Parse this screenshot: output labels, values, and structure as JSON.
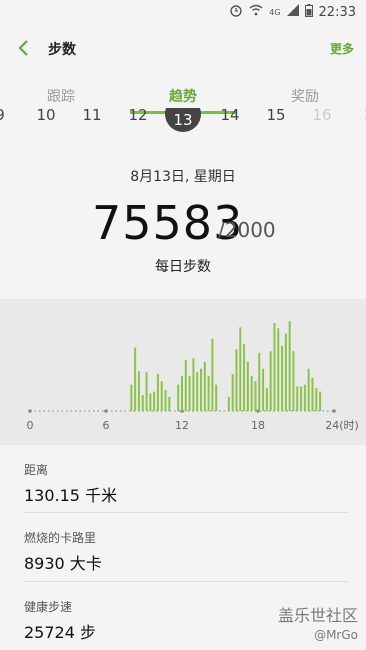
{
  "status": {
    "network": "4G",
    "time": "22:33"
  },
  "header": {
    "title": "步数",
    "more_label": "更多"
  },
  "tabs": [
    {
      "label": "跟踪"
    },
    {
      "label": "趋势",
      "active": true
    },
    {
      "label": "奖励"
    }
  ],
  "days": [
    "9",
    "10",
    "11",
    "12",
    "13",
    "14",
    "15",
    "16",
    "1"
  ],
  "selected_day": "13",
  "summary": {
    "date": "8月13日, 星期日",
    "steps": "75583",
    "goal": "/2000",
    "label": "每日步数"
  },
  "chart_data": {
    "type": "bar",
    "xlabel": "",
    "ylabel": "",
    "x_tick_labels": [
      "0",
      "6",
      "12",
      "18",
      "24(时)"
    ],
    "x_range": [
      0,
      24
    ],
    "bar_color": "#8bc34a",
    "bars": [
      {
        "x": 8.0,
        "v": 0.3
      },
      {
        "x": 8.3,
        "v": 0.72
      },
      {
        "x": 8.6,
        "v": 0.45
      },
      {
        "x": 8.9,
        "v": 0.18
      },
      {
        "x": 9.2,
        "v": 0.44
      },
      {
        "x": 9.5,
        "v": 0.2
      },
      {
        "x": 9.8,
        "v": 0.22
      },
      {
        "x": 10.1,
        "v": 0.42
      },
      {
        "x": 10.4,
        "v": 0.34
      },
      {
        "x": 10.7,
        "v": 0.24
      },
      {
        "x": 11.0,
        "v": 0.16
      },
      {
        "x": 11.7,
        "v": 0.3
      },
      {
        "x": 12.0,
        "v": 0.4
      },
      {
        "x": 12.3,
        "v": 0.58
      },
      {
        "x": 12.6,
        "v": 0.4
      },
      {
        "x": 12.9,
        "v": 0.6
      },
      {
        "x": 13.2,
        "v": 0.44
      },
      {
        "x": 13.5,
        "v": 0.48
      },
      {
        "x": 13.8,
        "v": 0.56
      },
      {
        "x": 14.1,
        "v": 0.4
      },
      {
        "x": 14.4,
        "v": 0.82
      },
      {
        "x": 14.7,
        "v": 0.3
      },
      {
        "x": 15.7,
        "v": 0.16
      },
      {
        "x": 16.0,
        "v": 0.42
      },
      {
        "x": 16.3,
        "v": 0.7
      },
      {
        "x": 16.6,
        "v": 0.95
      },
      {
        "x": 16.9,
        "v": 0.76
      },
      {
        "x": 17.2,
        "v": 0.56
      },
      {
        "x": 17.5,
        "v": 0.4
      },
      {
        "x": 17.8,
        "v": 0.34
      },
      {
        "x": 18.1,
        "v": 0.66
      },
      {
        "x": 18.4,
        "v": 0.48
      },
      {
        "x": 18.7,
        "v": 0.26
      },
      {
        "x": 19.0,
        "v": 0.68
      },
      {
        "x": 19.3,
        "v": 1.0
      },
      {
        "x": 19.6,
        "v": 0.94
      },
      {
        "x": 19.9,
        "v": 0.74
      },
      {
        "x": 20.2,
        "v": 0.88
      },
      {
        "x": 20.5,
        "v": 1.02
      },
      {
        "x": 20.8,
        "v": 0.68
      },
      {
        "x": 21.1,
        "v": 0.28
      },
      {
        "x": 21.4,
        "v": 0.28
      },
      {
        "x": 21.7,
        "v": 0.3
      },
      {
        "x": 22.0,
        "v": 0.48
      },
      {
        "x": 22.3,
        "v": 0.38
      },
      {
        "x": 22.6,
        "v": 0.26
      },
      {
        "x": 22.9,
        "v": 0.22
      }
    ]
  },
  "info": [
    {
      "label": "距离",
      "value": "130.15 千米"
    },
    {
      "label": "燃烧的卡路里",
      "value": "8930 大卡"
    },
    {
      "label": "健康步速",
      "value": "25724 步"
    }
  ],
  "watermark": {
    "title": "盖乐世社区",
    "user": "@MrGo"
  }
}
